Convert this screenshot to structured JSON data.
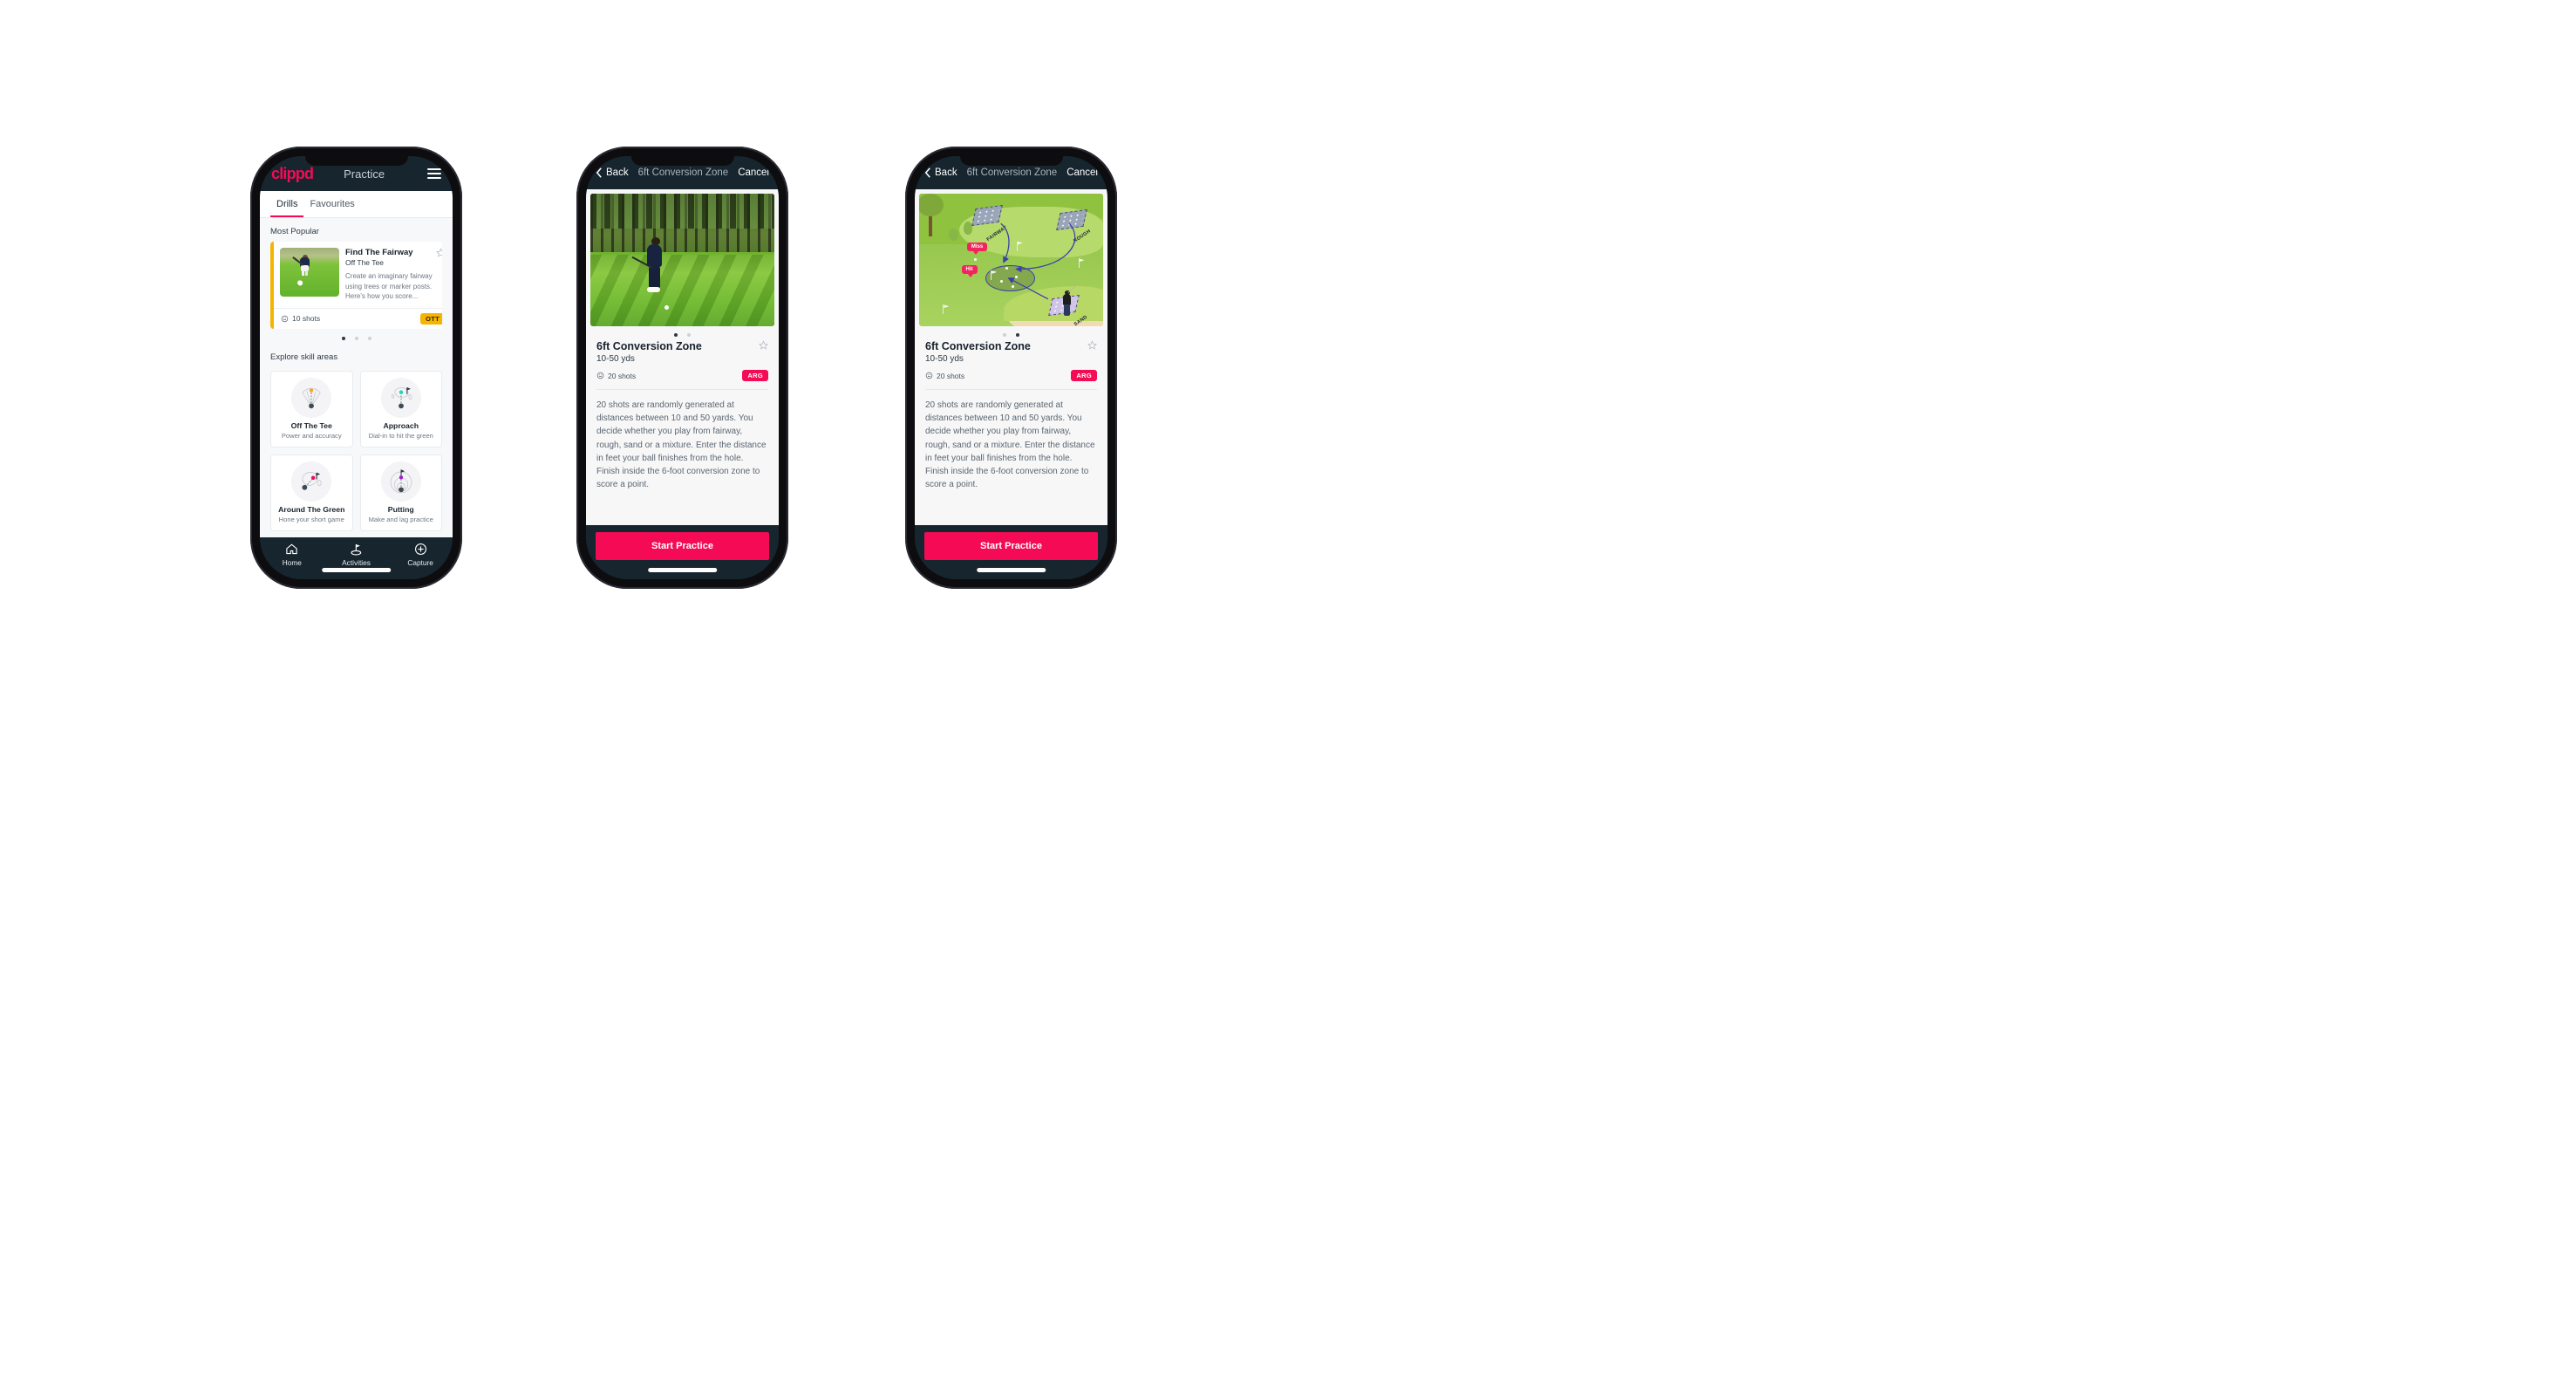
{
  "phone1": {
    "topbar": {
      "brand": "clippd",
      "title": "Practice",
      "menu_icon": "hamburger-menu-icon"
    },
    "tabs": [
      {
        "label": "Drills",
        "active": true
      },
      {
        "label": "Favourites",
        "active": false
      }
    ],
    "sections": {
      "most_popular": "Most Popular",
      "explore": "Explore skill areas"
    },
    "featured_drill": {
      "title": "Find The Fairway",
      "subtitle": "Off The Tee",
      "description": "Create an imaginary fairway using trees or marker posts. Here's how you score...",
      "shots": "10 shots",
      "badge": "OTT",
      "badge_color": "#f5b400",
      "accent_color": "#f5b400",
      "star_icon": "star-outline-icon",
      "shots_icon": "shots-clock-icon"
    },
    "carousel_dots": {
      "count": 3,
      "active_index": 0
    },
    "skills": [
      {
        "name": "Off The Tee",
        "desc": "Power and accuracy",
        "icon": "tee-dispersion-icon",
        "dot_color": "#f5a623"
      },
      {
        "name": "Approach",
        "desc": "Dial-in to hit the green",
        "icon": "approach-green-icon",
        "dot_color": "#24d6bb"
      },
      {
        "name": "Around The Green",
        "desc": "Hone your short game",
        "icon": "chip-green-icon",
        "dot_color": "#f50b55"
      },
      {
        "name": "Putting",
        "desc": "Make and lag practice",
        "icon": "putting-rings-icon",
        "dot_color": "#a020d0"
      }
    ],
    "nav": [
      {
        "label": "Home",
        "icon": "home-icon",
        "active": false
      },
      {
        "label": "Activities",
        "icon": "golf-flag-icon",
        "active": true
      },
      {
        "label": "Capture",
        "icon": "plus-circle-icon",
        "active": false
      }
    ]
  },
  "phone2": {
    "topbar": {
      "back": "Back",
      "title": "6ft Conversion Zone",
      "cancel": "Cancel",
      "back_icon": "chevron-left-icon"
    },
    "media": {
      "type": "photo",
      "alt": "golfer-pitching-photo"
    },
    "carousel_dots": {
      "count": 2,
      "active_index": 0
    },
    "detail": {
      "title": "6ft Conversion Zone",
      "distance": "10-50 yds",
      "shots": "20 shots",
      "badge": "ARG",
      "badge_color": "#f50b55",
      "star_icon": "star-outline-icon",
      "shots_icon": "shots-clock-icon",
      "description": "20 shots are randomly generated at distances between 10 and 50 yards. You decide whether you play from fairway, rough, sand or a mixture. Enter the distance in feet your ball finishes from the hole. Finish inside the 6-foot conversion zone to score a point."
    },
    "cta": "Start Practice"
  },
  "phone3": {
    "topbar": {
      "back": "Back",
      "title": "6ft Conversion Zone",
      "cancel": "Cancel",
      "back_icon": "chevron-left-icon"
    },
    "media": {
      "type": "illustration",
      "alt": "golf-course-diagram",
      "labels": [
        {
          "text": "FAIRWAY"
        },
        {
          "text": "ROUGH"
        },
        {
          "text": "SAND"
        }
      ],
      "tags": [
        {
          "text": "Miss",
          "color": "#f2245d"
        },
        {
          "text": "Hit",
          "color": "#f2245d"
        }
      ]
    },
    "carousel_dots": {
      "count": 2,
      "active_index": 1
    },
    "detail": {
      "title": "6ft Conversion Zone",
      "distance": "10-50 yds",
      "shots": "20 shots",
      "badge": "ARG",
      "badge_color": "#f50b55",
      "star_icon": "star-outline-icon",
      "shots_icon": "shots-clock-icon",
      "description": "20 shots are randomly generated at distances between 10 and 50 yards. You decide whether you play from fairway, rough, sand or a mixture. Enter the distance in feet your ball finishes from the hole. Finish inside the 6-foot conversion zone to score a point."
    },
    "cta": "Start Practice"
  }
}
